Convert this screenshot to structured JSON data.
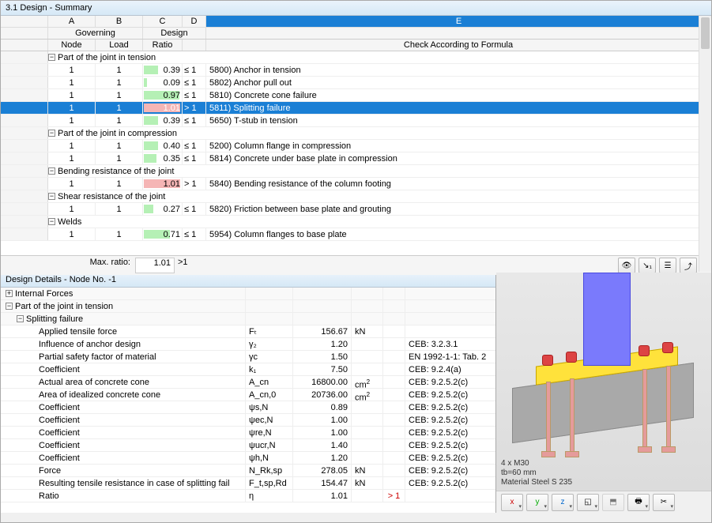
{
  "window_title": "3.1 Design - Summary",
  "columns": {
    "letters": [
      "A",
      "B",
      "C",
      "D",
      "E"
    ],
    "group_ab": "Governing",
    "group_cd": "Design",
    "sub_a": "Node",
    "sub_b": "Load",
    "sub_c": "Ratio",
    "sub_e": "Check According to Formula"
  },
  "rows": [
    {
      "type": "group",
      "label": "Part of the joint in tension"
    },
    {
      "node": "1",
      "load": "1",
      "ratio": "0.39",
      "cond": "≤ 1",
      "desc": "5800) Anchor in tension",
      "bar": 0.39
    },
    {
      "node": "1",
      "load": "1",
      "ratio": "0.09",
      "cond": "≤ 1",
      "desc": "5802) Anchor pull out",
      "bar": 0.09
    },
    {
      "node": "1",
      "load": "1",
      "ratio": "0.97",
      "cond": "≤ 1",
      "desc": "5810) Concrete cone failure",
      "bar": 0.97
    },
    {
      "node": "1",
      "load": "1",
      "ratio": "1.01",
      "cond": "> 1",
      "desc": "5811) Splitting failure",
      "bar": 1.0,
      "red": true,
      "selected": true
    },
    {
      "node": "1",
      "load": "1",
      "ratio": "0.39",
      "cond": "≤ 1",
      "desc": "5650) T-stub in tension",
      "bar": 0.39
    },
    {
      "type": "group",
      "label": "Part of the joint in compression"
    },
    {
      "node": "1",
      "load": "1",
      "ratio": "0.40",
      "cond": "≤ 1",
      "desc": "5200) Column flange in compression",
      "bar": 0.4
    },
    {
      "node": "1",
      "load": "1",
      "ratio": "0.35",
      "cond": "≤ 1",
      "desc": "5814) Concrete under base plate in compression",
      "bar": 0.35
    },
    {
      "type": "group",
      "label": "Bending resistance of the joint"
    },
    {
      "node": "1",
      "load": "1",
      "ratio": "1.01",
      "cond": "> 1",
      "desc": "5840) Bending resistance of the column footing",
      "bar": 1.0,
      "red": true
    },
    {
      "type": "group",
      "label": "Shear resistance of the joint"
    },
    {
      "node": "1",
      "load": "1",
      "ratio": "0.27",
      "cond": "≤ 1",
      "desc": "5820) Friction between base plate and grouting",
      "bar": 0.27
    },
    {
      "type": "group",
      "label": "Welds"
    },
    {
      "node": "1",
      "load": "1",
      "ratio": "0.71",
      "cond": "≤ 1",
      "desc": "5954) Column flanges to base plate",
      "bar": 0.71
    }
  ],
  "max_ratio": {
    "label": "Max. ratio:",
    "value": "1.01",
    "cond": ">1"
  },
  "toolbar_icons": [
    "eye-icon",
    "goto-icon",
    "list-icon",
    "export-icon"
  ],
  "details_title": "Design Details  -  Node No. -1",
  "details": [
    {
      "type": "grp",
      "level": 0,
      "label": "Internal Forces",
      "toggle": "+"
    },
    {
      "type": "grp",
      "level": 0,
      "label": "Part of the joint in tension",
      "toggle": "−"
    },
    {
      "type": "grp",
      "level": 1,
      "label": "Splitting failure",
      "toggle": "−"
    },
    {
      "label": "Applied tensile force",
      "sym": "Fₜ",
      "val": "156.67",
      "unit": "kN",
      "ref": ""
    },
    {
      "label": "Influence of anchor design",
      "sym": "γ₂",
      "val": "1.20",
      "unit": "",
      "ref": "CEB: 3.2.3.1"
    },
    {
      "label": "Partial safety factor of material",
      "sym": "γc",
      "val": "1.50",
      "unit": "",
      "ref": "EN 1992-1-1: Tab. 2"
    },
    {
      "label": "Coefficient",
      "sym": "k₁",
      "val": "7.50",
      "unit": "",
      "ref": "CEB: 9.2.4(a)"
    },
    {
      "label": "Actual area of concrete cone",
      "sym": "A_cn",
      "val": "16800.00",
      "unit": "cm²",
      "ref": "CEB: 9.2.5.2(c)"
    },
    {
      "label": "Area of idealized concrete cone",
      "sym": "A_cn,0",
      "val": "20736.00",
      "unit": "cm²",
      "ref": "CEB: 9.2.5.2(c)"
    },
    {
      "label": "Coefficient",
      "sym": "ψs,N",
      "val": "0.89",
      "unit": "",
      "ref": "CEB: 9.2.5.2(c)"
    },
    {
      "label": "Coefficient",
      "sym": "ψec,N",
      "val": "1.00",
      "unit": "",
      "ref": "CEB: 9.2.5.2(c)"
    },
    {
      "label": "Coefficient",
      "sym": "ψre,N",
      "val": "1.00",
      "unit": "",
      "ref": "CEB: 9.2.5.2(c)"
    },
    {
      "label": "Coefficient",
      "sym": "ψucr,N",
      "val": "1.40",
      "unit": "",
      "ref": "CEB: 9.2.5.2(c)"
    },
    {
      "label": "Coefficient",
      "sym": "ψh,N",
      "val": "1.20",
      "unit": "",
      "ref": "CEB: 9.2.5.2(c)"
    },
    {
      "label": "Force",
      "sym": "N_Rk,sp",
      "val": "278.05",
      "unit": "kN",
      "ref": "CEB: 9.2.5.2(c)"
    },
    {
      "label": "Resulting tensile resistance in case of splitting fail",
      "sym": "F_t,sp,Rd",
      "val": "154.47",
      "unit": "kN",
      "ref": "CEB: 9.2.5.2(c)"
    },
    {
      "label": "Ratio",
      "sym": "η",
      "val": "1.01",
      "unit": "",
      "cond": "> 1",
      "ref": ""
    }
  ],
  "preview": {
    "info1": "4 x M30",
    "info2": "tb=60 mm",
    "info3": "Material Steel S 235"
  },
  "preview_buttons": [
    "axis-x",
    "axis-y",
    "axis-z",
    "view-3d",
    "view-render",
    "print",
    "screenshot"
  ]
}
